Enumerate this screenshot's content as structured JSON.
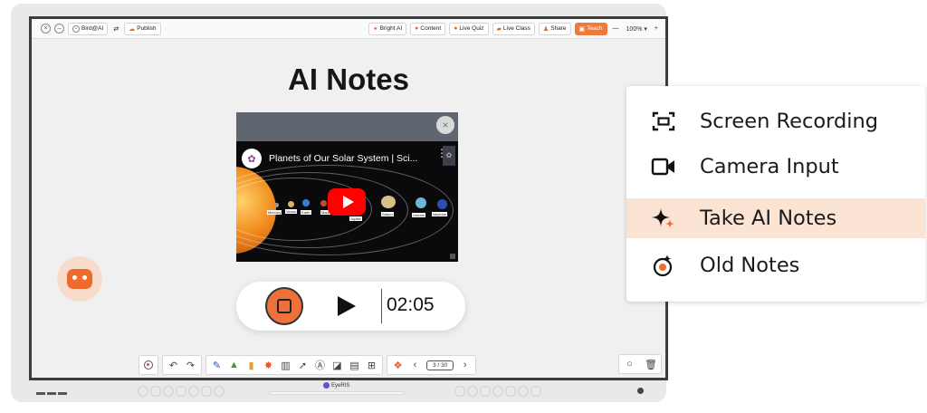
{
  "topbar": {
    "left_items": [
      "Bird@AI",
      "Publish"
    ],
    "right_items": [
      {
        "label": "Bright AI",
        "icon": "sparkle-icon"
      },
      {
        "label": "Content",
        "icon": "content-icon"
      },
      {
        "label": "Live Quiz",
        "icon": "quiz-icon"
      },
      {
        "label": "Live Class",
        "icon": "class-icon"
      },
      {
        "label": "Share",
        "icon": "share-icon"
      },
      {
        "label": "Teach",
        "icon": "teach-icon"
      }
    ],
    "zoom": "100%",
    "zoom_minus": "—",
    "zoom_plus": "+"
  },
  "main": {
    "title": "AI Notes"
  },
  "video": {
    "title": "Planets of Our Solar System | Sci...",
    "planets": [
      "Mercury",
      "Venus",
      "Earth",
      "Mars",
      "Jupiter",
      "Saturn",
      "Uranus",
      "Neptune"
    ]
  },
  "recorder": {
    "time": "02:05"
  },
  "bottom_toolbar": {
    "page_indicator": "3 / 30"
  },
  "bezel": {
    "brand": "EyeRIS"
  },
  "menu": {
    "items": [
      {
        "label": "Screen Recording",
        "icon": "screen-record-icon"
      },
      {
        "label": "Camera Input",
        "icon": "camera-icon"
      },
      {
        "label": "Take AI Notes",
        "icon": "sparkle-icon"
      },
      {
        "label": "Old Notes",
        "icon": "notes-history-icon"
      }
    ],
    "active_index": 2,
    "accent": "#ef6b2c",
    "active_bg": "#fbe4d4"
  }
}
